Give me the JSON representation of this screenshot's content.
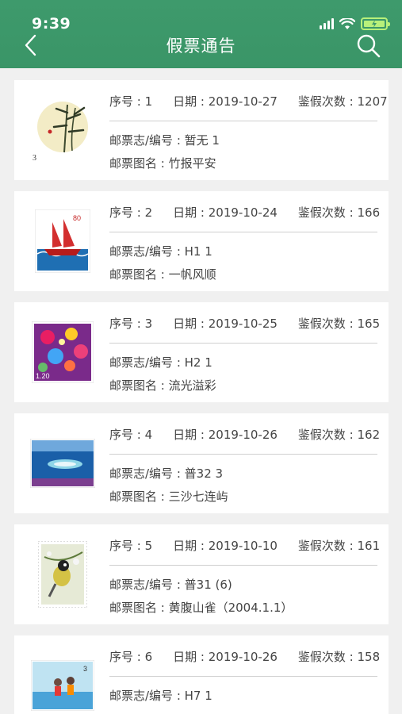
{
  "status_bar": {
    "time": "9:39"
  },
  "nav": {
    "title": "假票通告"
  },
  "labels": {
    "seq": "序号",
    "date": "日期",
    "count": "鉴假次数",
    "code": "邮票志/编号",
    "name": "邮票图名"
  },
  "items": [
    {
      "seq_text": "序号 : 1",
      "date_text": "日期 : 2019-10-27",
      "count_text": "鉴假次数 : 1207",
      "code_text": "邮票志/编号 : 暂无   1",
      "name_text": "邮票图名 : 竹报平安",
      "thumb": "stamp-bamboo"
    },
    {
      "seq_text": "序号 : 2",
      "date_text": "日期 : 2019-10-24",
      "count_text": "鉴假次数 : 166",
      "code_text": "邮票志/编号 : H1   1",
      "name_text": "邮票图名 : 一帆风顺",
      "thumb": "stamp-sailboat"
    },
    {
      "seq_text": "序号 : 3",
      "date_text": "日期 : 2019-10-25",
      "count_text": "鉴假次数 : 165",
      "code_text": "邮票志/编号 : H2   1",
      "name_text": "邮票图名 : 流光溢彩",
      "thumb": "stamp-fireworks"
    },
    {
      "seq_text": "序号 : 4",
      "date_text": "日期 : 2019-10-26",
      "count_text": "鉴假次数 : 162",
      "code_text": "邮票志/编号 : 普32   3",
      "name_text": "邮票图名 : 三沙七连屿",
      "thumb": "stamp-islands"
    },
    {
      "seq_text": "序号 : 5",
      "date_text": "日期 : 2019-10-10",
      "count_text": "鉴假次数 : 161",
      "code_text": "邮票志/编号 : 普31    (6)",
      "name_text": "邮票图名 : 黄腹山雀（2004.1.1）",
      "thumb": "stamp-bird"
    },
    {
      "seq_text": "序号 : 6",
      "date_text": "日期 : 2019-10-26",
      "count_text": "鉴假次数 : 158",
      "code_text": "邮票志/编号 : H7   1",
      "name_text": "",
      "thumb": "stamp-children"
    }
  ]
}
